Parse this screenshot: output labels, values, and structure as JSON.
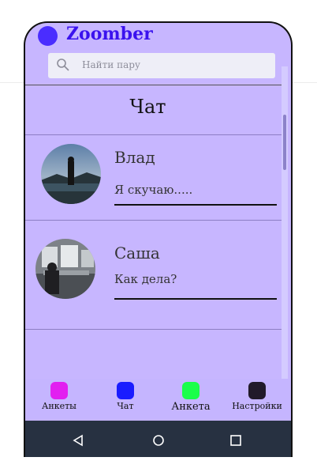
{
  "app": {
    "brand": "Zoomber"
  },
  "search": {
    "placeholder": "Найти пару"
  },
  "page": {
    "title": "Чат"
  },
  "chats": [
    {
      "name": "Влад",
      "message": "Я скучаю....."
    },
    {
      "name": "Саша",
      "message": "Как дела?"
    }
  ],
  "nav": {
    "items": [
      {
        "label": "Анкеты",
        "color": "#e21ff0"
      },
      {
        "label": "Чат",
        "color": "#1a1cff"
      },
      {
        "label": "Анкета",
        "color": "#1aff4a"
      },
      {
        "label": "Настройки",
        "color": "#211a2a"
      }
    ]
  },
  "system_nav": {
    "back_icon": "back-triangle-icon",
    "home_icon": "home-circle-icon",
    "recents_icon": "recents-square-icon"
  }
}
